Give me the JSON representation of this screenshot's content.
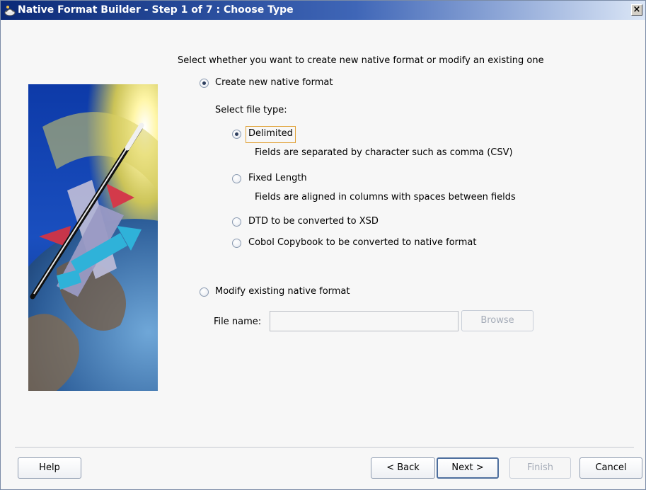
{
  "window": {
    "title": "Native Format Builder - Step 1 of 7 : Choose Type",
    "close_label": "×"
  },
  "main": {
    "instruction": "Select whether you want to create new native format or modify an existing one",
    "create_option": {
      "label": "Create new native format",
      "checked": true
    },
    "file_type_label": "Select file type:",
    "file_types": [
      {
        "label": "Delimited",
        "description": "Fields are separated by character such as comma (CSV)",
        "checked": true
      },
      {
        "label": "Fixed Length",
        "description": "Fields are aligned in columns with spaces between fields",
        "checked": false
      },
      {
        "label": "DTD to be converted to XSD",
        "checked": false
      },
      {
        "label": "Cobol Copybook to be converted to native format",
        "checked": false
      }
    ],
    "modify_option": {
      "label": "Modify existing native format",
      "checked": false
    },
    "file_name_label": "File name:",
    "file_name_value": "",
    "browse_label": "Browse"
  },
  "footer": {
    "help": "Help",
    "back": "< Back",
    "next": "Next >",
    "finish": "Finish",
    "cancel": "Cancel"
  },
  "colors": {
    "titlebar_start": "#0b2a77",
    "titlebar_end": "#dbe6f6",
    "focus_outline": "#e1a33a",
    "dialog_bg": "#f7f7f7"
  },
  "icons": [
    "wizard-icon",
    "close-icon",
    "wizard-illustration"
  ]
}
